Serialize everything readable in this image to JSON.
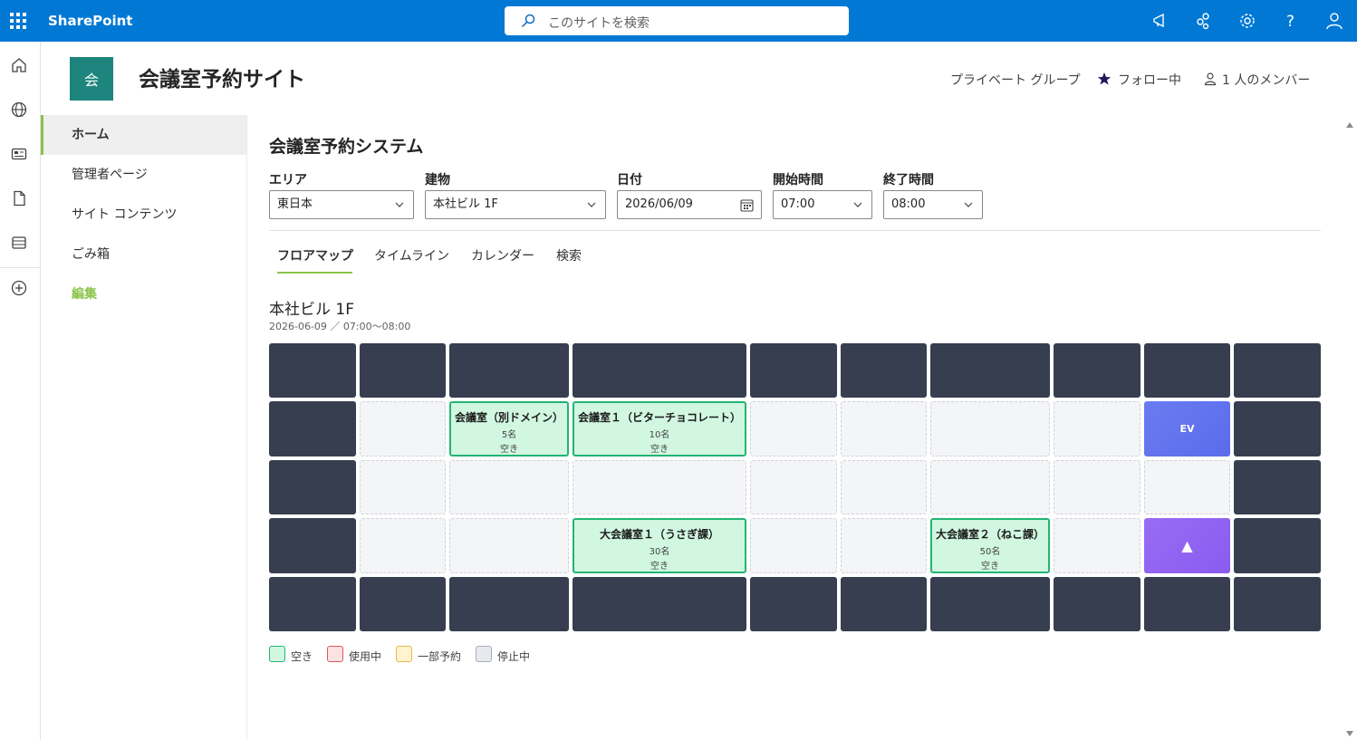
{
  "suite": {
    "brand": "SharePoint",
    "search_placeholder": "このサイトを検索"
  },
  "site": {
    "logo_letter": "会",
    "title": "会議室予約サイト",
    "privacy": "プライベート グループ",
    "follow": "フォロー中",
    "members": "1 人のメンバー"
  },
  "nav": {
    "items": [
      {
        "label": "ホーム"
      },
      {
        "label": "管理者ページ"
      },
      {
        "label": "サイト コンテンツ"
      },
      {
        "label": "ごみ箱"
      },
      {
        "label": "編集"
      }
    ]
  },
  "main": {
    "title": "会議室予約システム",
    "filters": {
      "area": {
        "label": "エリア",
        "value": "東日本"
      },
      "building": {
        "label": "建物",
        "value": "本社ビル 1F"
      },
      "date": {
        "label": "日付",
        "value": "2026/06/09"
      },
      "start": {
        "label": "開始時間",
        "value": "07:00"
      },
      "end": {
        "label": "終了時間",
        "value": "08:00"
      }
    },
    "tabs": [
      {
        "label": "フロアマップ"
      },
      {
        "label": "タイムライン"
      },
      {
        "label": "カレンダー"
      },
      {
        "label": "検索"
      }
    ],
    "floor": {
      "title": "本社ビル 1F",
      "subtitle": "2026-06-09 ／ 07:00〜08:00",
      "rooms": [
        {
          "name": "会議室（別ドメイン）",
          "capacity": "5名",
          "status": "空き"
        },
        {
          "name": "会議室１（ビターチョコレート）",
          "capacity": "10名",
          "status": "空き"
        },
        {
          "name": "大会議室１（うさぎ課）",
          "capacity": "30名",
          "status": "空き"
        },
        {
          "name": "大会議室２（ねこ課）",
          "capacity": "50名",
          "status": "空き"
        }
      ],
      "ev_label": "EV",
      "stairs_glyph": "▲"
    },
    "legend": [
      {
        "label": "空き",
        "fill": "#d1f7e1",
        "border": "#22b573"
      },
      {
        "label": "使用中",
        "fill": "#fde2e2",
        "border": "#e05757"
      },
      {
        "label": "一部予約",
        "fill": "#fff4cf",
        "border": "#e8b84a"
      },
      {
        "label": "停止中",
        "fill": "#e8e9ee",
        "border": "#a9adb8"
      }
    ]
  },
  "colors": {
    "suite_bar": "#0078d4",
    "wall": "#363e4f",
    "accent": "#8bc34a",
    "site_logo": "#1d857d"
  }
}
